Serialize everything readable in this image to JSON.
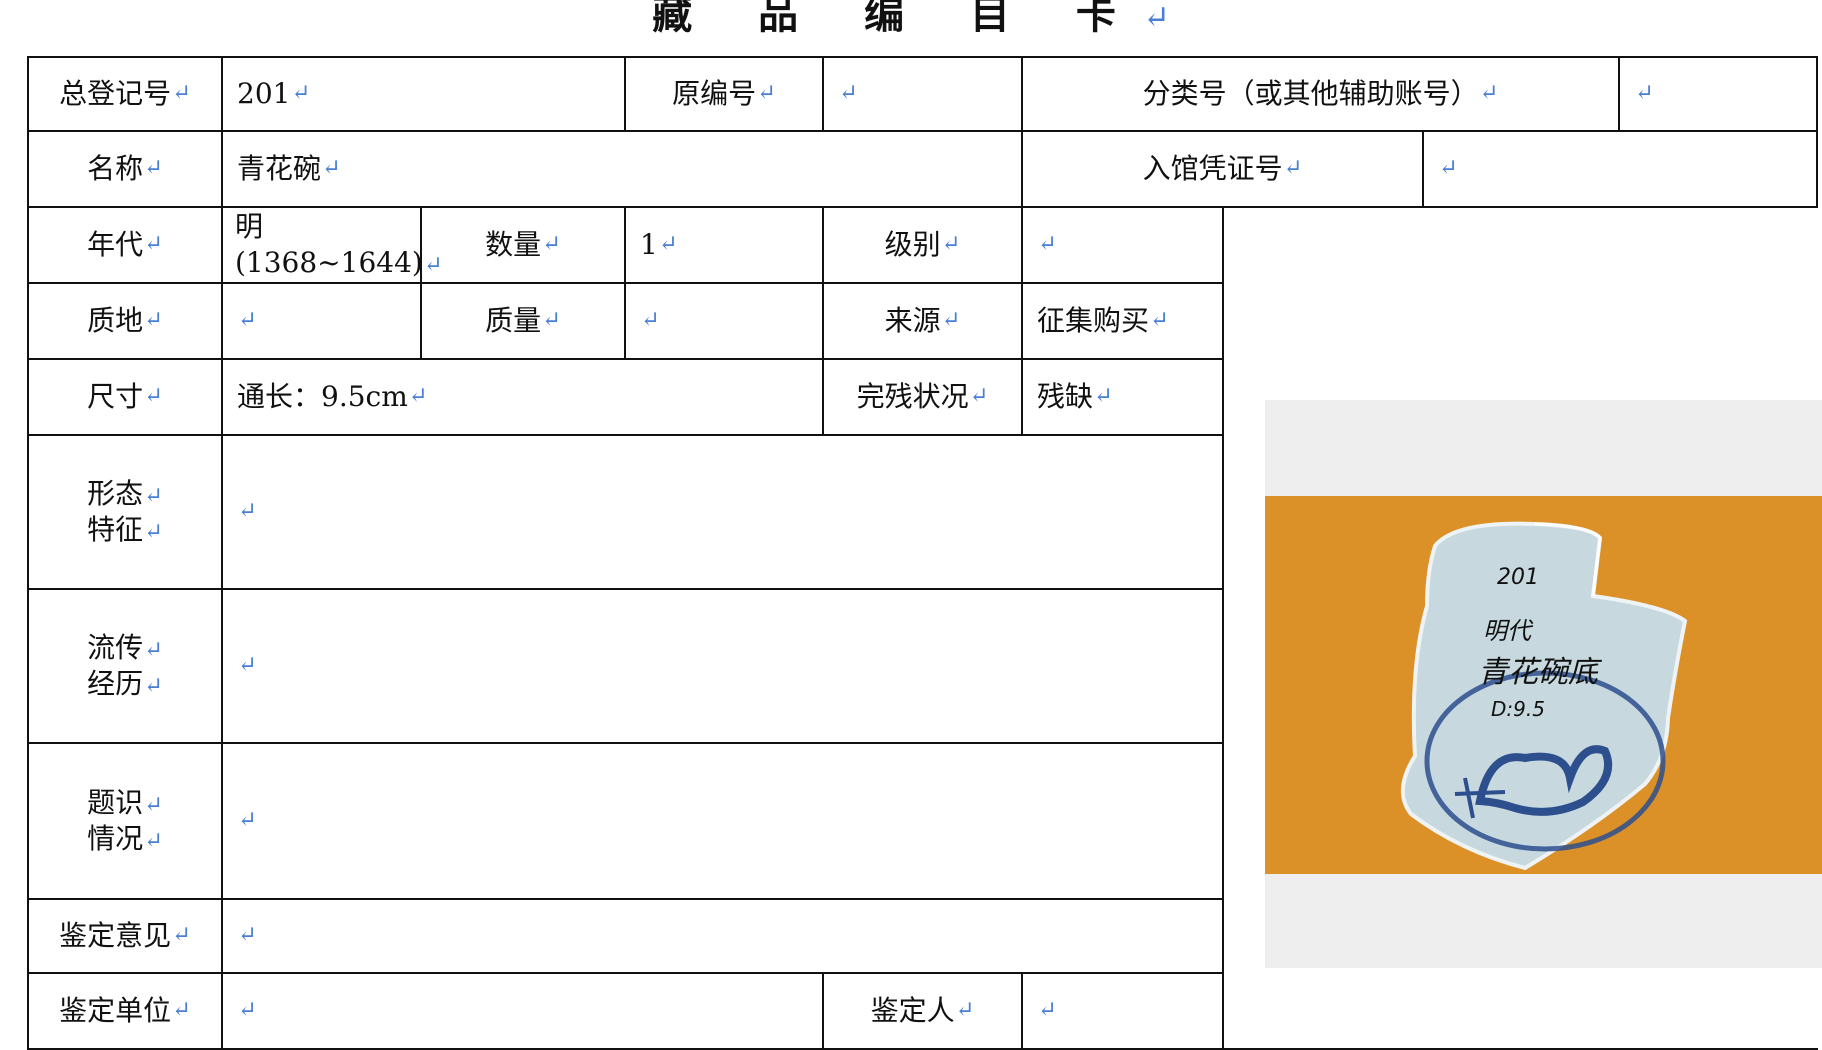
{
  "title": "藏 品 编 目 卡",
  "rows": {
    "r1": {
      "reg_label": "总登记号",
      "reg_value": "201",
      "orig_label": "原编号",
      "orig_value": "",
      "class_label": "分类号（或其他辅助账号）",
      "class_value": ""
    },
    "r2": {
      "name_label": "名称",
      "name_value": "青花碗",
      "voucher_label": "入馆凭证号",
      "voucher_value": ""
    },
    "r3": {
      "era_label": "年代",
      "era_value_1": "明",
      "era_value_2": "(1368~1644)",
      "qty_label": "数量",
      "qty_value": "1",
      "grade_label": "级别",
      "grade_value": ""
    },
    "r4": {
      "material_label": "质地",
      "material_value": "",
      "weight_label": "质量",
      "weight_value": "",
      "source_label": "来源",
      "source_value": "征集购买"
    },
    "r5": {
      "size_label": "尺寸",
      "size_value": "通长：9.5cm",
      "condition_label": "完残状况",
      "condition_value": "残缺"
    },
    "r6": {
      "label_1": "形态",
      "label_2": "特征",
      "value": ""
    },
    "r7": {
      "label_1": "流传",
      "label_2": "经历",
      "value": ""
    },
    "r8": {
      "label_1": "题识",
      "label_2": "情况",
      "value": ""
    },
    "r9": {
      "label": "鉴定意见",
      "value": ""
    },
    "r10": {
      "unit_label": "鉴定单位",
      "unit_value": "",
      "person_label": "鉴定人",
      "person_value": ""
    }
  },
  "photo": {
    "inscription_number": "201",
    "inscription_era": "明代",
    "inscription_name": "青花碗底",
    "inscription_size": "D:9.5",
    "colors": {
      "background": "#e1962d",
      "porcelain": "#c7d8de",
      "cobalt": "#2d4f8e"
    }
  }
}
